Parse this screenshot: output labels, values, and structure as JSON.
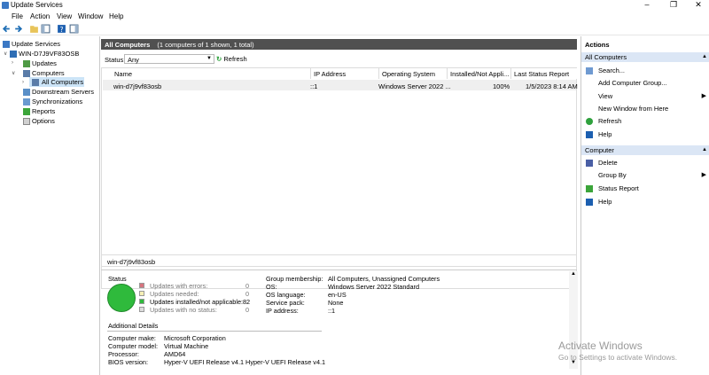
{
  "window": {
    "title": "Update Services"
  },
  "menu": [
    "File",
    "Action",
    "View",
    "Window",
    "Help"
  ],
  "tree": {
    "root": "Update Services",
    "server": "WIN-D7J9VF83OSB",
    "updates": "Updates",
    "computers": "Computers",
    "all_computers": "All Computers",
    "downstream": "Downstream Servers",
    "sync": "Synchronizations",
    "reports": "Reports",
    "options": "Options"
  },
  "center": {
    "header_title": "All Computers",
    "header_sub": "(1 computers of 1 shown, 1 total)",
    "status_label": "Status:",
    "status_value": "Any",
    "refresh_label": "Refresh",
    "columns": [
      "Name",
      "IP Address",
      "Operating System",
      "Installed/Not Appli...",
      "Last Status Report"
    ],
    "row": {
      "name": "win-d7j9vf83osb",
      "ip": "::1",
      "os": "Windows Server 2022 ...",
      "installed": "100%",
      "last_report": "1/5/2023 8:14 AM"
    },
    "detail_name": "win-d7j9vf83osb"
  },
  "details": {
    "status_title": "Status",
    "legend": [
      {
        "label": "Updates with errors:",
        "value": "0",
        "color": "#d7747e"
      },
      {
        "label": "Updates needed:",
        "value": "0",
        "color": "#f6efb6"
      },
      {
        "label": "Updates installed/not applicable:",
        "value": "82",
        "color": "#2fba3c"
      },
      {
        "label": "Updates with no status:",
        "value": "0",
        "color": "#dcdcdc"
      }
    ],
    "info": [
      {
        "k": "Group membership:",
        "v": "All Computers, Unassigned Computers"
      },
      {
        "k": "OS:",
        "v": "Windows Server 2022 Standard"
      },
      {
        "k": "OS language:",
        "v": "en-US"
      },
      {
        "k": "Service pack:",
        "v": "None"
      },
      {
        "k": "IP address:",
        "v": "::1"
      }
    ],
    "additional_title": "Additional Details",
    "additional": [
      {
        "k": "Computer make:",
        "v": "Microsoft Corporation"
      },
      {
        "k": "Computer model:",
        "v": "Virtual Machine"
      },
      {
        "k": "Processor:",
        "v": "AMD64"
      },
      {
        "k": "BIOS version:",
        "v": "Hyper-V UEFI Release v4.1 Hyper-V UEFI Release v4.1"
      }
    ]
  },
  "actions": {
    "title": "Actions",
    "section1": "All Computers",
    "items1": [
      "Search...",
      "Add Computer Group...",
      "View",
      "New Window from Here",
      "Refresh",
      "Help"
    ],
    "section2": "Computer",
    "items2": [
      "Delete",
      "Group By",
      "Status Report",
      "Help"
    ]
  },
  "watermark": {
    "line1": "Activate Windows",
    "line2": "Go to Settings to activate Windows."
  },
  "colors": {
    "header_bg": "#505050",
    "section_bg": "#dbe6f5",
    "status_green": "#2fba3c"
  }
}
